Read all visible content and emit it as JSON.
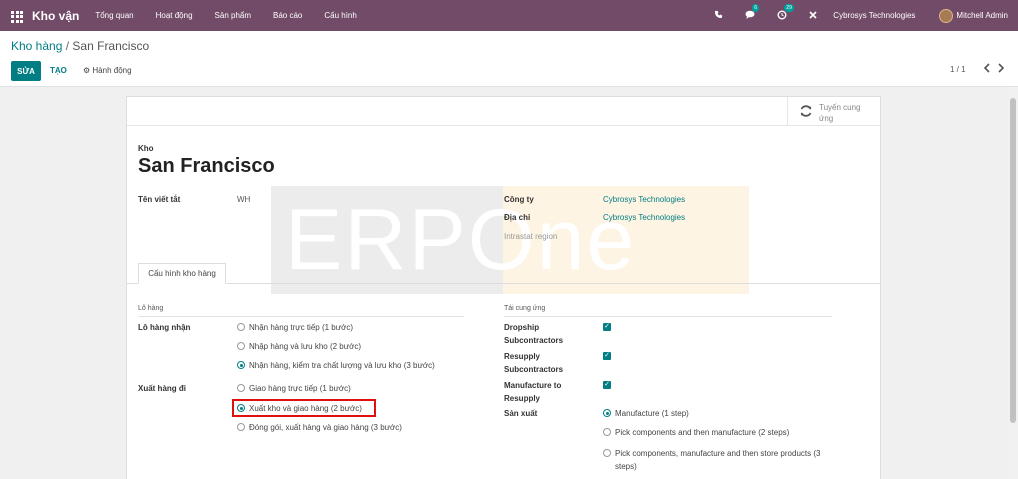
{
  "navbar": {
    "app_title": "Kho vận",
    "menu": [
      "Tổng quan",
      "Hoạt động",
      "Sản phẩm",
      "Báo cáo",
      "Cấu hình"
    ],
    "messages_count": "6",
    "activities_count": "29",
    "company": "Cybrosys Technologies",
    "user": "Mitchell Admin"
  },
  "breadcrumb": {
    "parent": "Kho hàng",
    "separator": "/",
    "current": "San Francisco"
  },
  "toolbar": {
    "edit": "SỬA",
    "create": "TẠO",
    "action": "⚙ Hành động"
  },
  "pager": {
    "text": "1 / 1"
  },
  "stat_button": {
    "label": "Tuyến cung ứng"
  },
  "watermark": {
    "text": "ERPOne"
  },
  "form": {
    "warehouse_label": "Kho",
    "warehouse_name": "San Francisco",
    "short_name_label": "Tên viết tắt",
    "short_name": "WH",
    "company_label": "Công ty",
    "company": "Cybrosys Technologies",
    "address_label": "Địa chỉ",
    "address": "Cybrosys Technologies",
    "intrastat": "Intrastat region"
  },
  "tab": {
    "label": "Cấu hình kho hàng"
  },
  "shipments": {
    "section_title": "Lô hàng",
    "incoming_label": "Lô hàng nhận",
    "incoming_options": [
      "Nhận hàng trực tiếp (1 bước)",
      "Nhập hàng và lưu kho (2 bước)",
      "Nhận hàng, kiểm tra chất lượng và lưu kho (3 bước)"
    ],
    "incoming_selected": 2,
    "outgoing_label": "Xuất hàng đi",
    "outgoing_options": [
      "Giao hàng trực tiếp (1 bước)",
      "Xuất kho và giao hàng (2 bước)",
      "Đóng gói, xuất hàng và giao hàng (3 bước)"
    ],
    "outgoing_selected": 1
  },
  "resupply": {
    "section_title": "Tái cung ứng",
    "dropship_label": "Dropship Subcontractors",
    "resupply_sub_label": "Resupply Subcontractors",
    "manufacture_to_resupply_label": "Manufacture to Resupply",
    "dropship_checked": true,
    "resupply_sub_checked": true,
    "manufacture_to_resupply_checked": true,
    "manufacture_label": "Sản xuất",
    "manufacture_options": [
      "Manufacture (1 step)",
      "Pick components and then manufacture (2 steps)",
      "Pick components, manufacture and then store products (3 steps)"
    ],
    "manufacture_selected": 0
  }
}
